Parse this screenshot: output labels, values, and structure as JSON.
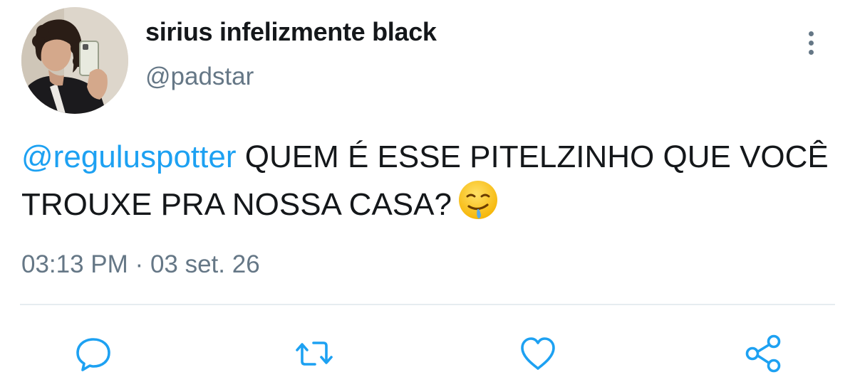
{
  "tweet": {
    "author": {
      "display_name": "sirius infelizmente black",
      "handle": "@padstar",
      "avatar_icon": "profile-photo"
    },
    "text": {
      "mention": "@reguluspotter",
      "body": " QUEM É ESSE PITELZINHO QUE VOCÊ TROUXE PRA NOSSA CASA?",
      "emoji": "drooling-face-emoji"
    },
    "meta": {
      "time": "03:13 PM",
      "separator": "·",
      "date": "03 set. 26"
    },
    "actions": [
      {
        "name": "reply",
        "icon": "speech-bubble-icon"
      },
      {
        "name": "retweet",
        "icon": "retweet-icon"
      },
      {
        "name": "like",
        "icon": "heart-icon"
      },
      {
        "name": "share",
        "icon": "share-icon"
      }
    ]
  },
  "colors": {
    "text": "#14171a",
    "secondary": "#657786",
    "link": "#1da1f2",
    "divider": "#e6ecf0",
    "icon": "#1da1f2"
  }
}
